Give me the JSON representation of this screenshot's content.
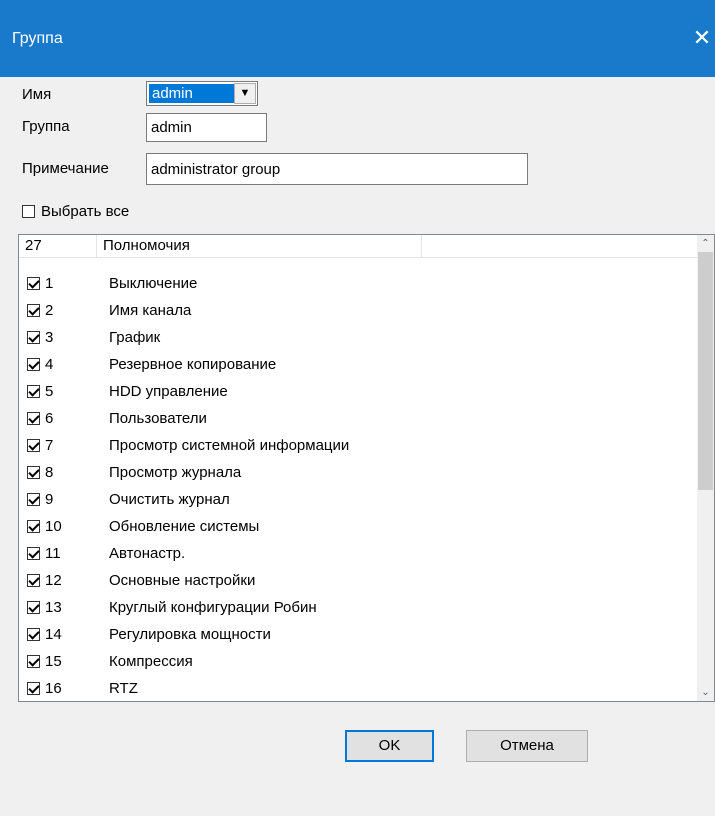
{
  "window": {
    "title": "Группа"
  },
  "form": {
    "name_label": "Имя",
    "name_value": "admin",
    "group_label": "Группа",
    "group_value": "admin",
    "note_label": "Примечание",
    "note_value": "administrator group"
  },
  "select_all": {
    "label": "Выбрать все",
    "checked": false
  },
  "list": {
    "header_count": "27",
    "header_permissions": "Полномочия",
    "rows": [
      {
        "num": "1",
        "name": "Выключение",
        "checked": true
      },
      {
        "num": "2",
        "name": "Имя канала",
        "checked": true
      },
      {
        "num": "3",
        "name": "График",
        "checked": true
      },
      {
        "num": "4",
        "name": "Резервное копирование",
        "checked": true
      },
      {
        "num": "5",
        "name": "HDD управление",
        "checked": true
      },
      {
        "num": "6",
        "name": "Пользователи",
        "checked": true
      },
      {
        "num": "7",
        "name": "Просмотр системной информации",
        "checked": true
      },
      {
        "num": "8",
        "name": "Просмотр журнала",
        "checked": true
      },
      {
        "num": "9",
        "name": "Очистить журнал",
        "checked": true
      },
      {
        "num": "10",
        "name": "Обновление системы",
        "checked": true
      },
      {
        "num": "11",
        "name": "Автонастр.",
        "checked": true
      },
      {
        "num": "12",
        "name": "Основные настройки",
        "checked": true
      },
      {
        "num": "13",
        "name": "Круглый конфигурации Робин",
        "checked": true
      },
      {
        "num": "14",
        "name": "Регулировка мощности",
        "checked": true
      },
      {
        "num": "15",
        "name": "Компрессия",
        "checked": true
      },
      {
        "num": "16",
        "name": "RTZ",
        "checked": true
      }
    ]
  },
  "buttons": {
    "ok": "OK",
    "cancel": "Отмена"
  },
  "colors": {
    "titlebar": "#1979ca",
    "selection": "#0078d7"
  }
}
